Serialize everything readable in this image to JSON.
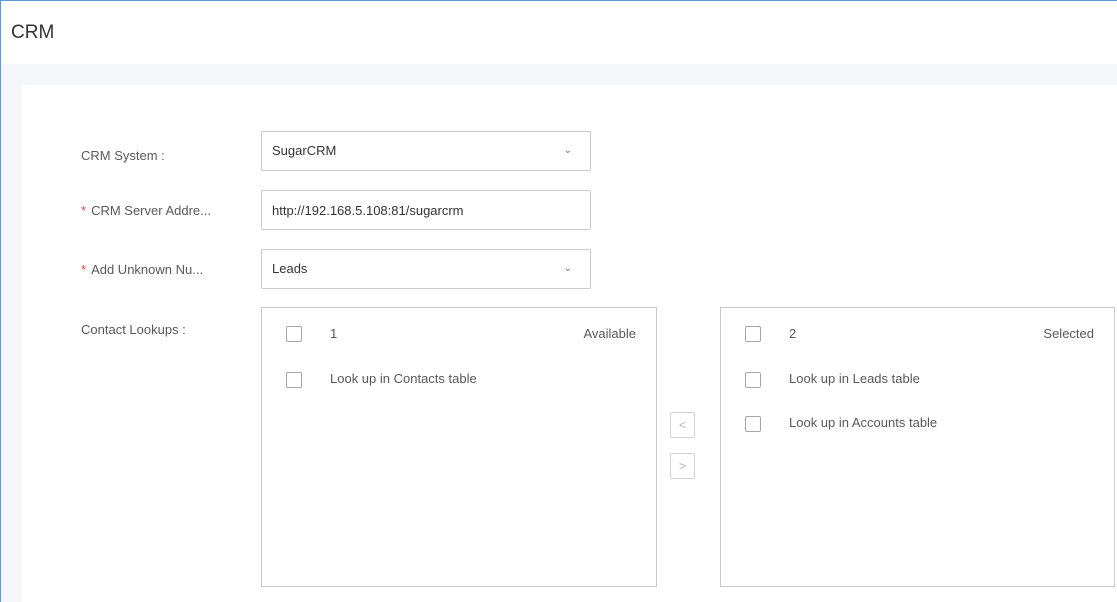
{
  "page": {
    "title": "CRM"
  },
  "form": {
    "crm_system": {
      "label": "CRM System :",
      "value": "SugarCRM"
    },
    "server_address": {
      "label": "CRM Server Addre...",
      "value": "http://192.168.5.108:81/sugarcrm",
      "required_mark": "*"
    },
    "add_unknown": {
      "label": "Add Unknown Nu...",
      "value": "Leads",
      "required_mark": "*"
    },
    "contact_lookups": {
      "label": "Contact Lookups :"
    }
  },
  "available": {
    "count": "1",
    "title": "Available",
    "items": [
      {
        "label": "Look up in Contacts table"
      }
    ]
  },
  "selected": {
    "count": "2",
    "title": "Selected",
    "items": [
      {
        "label": "Look up in Leads table"
      },
      {
        "label": "Look up in Accounts table"
      }
    ]
  },
  "transfer": {
    "left": "<",
    "right": ">"
  },
  "icons": {
    "dropdown": "chevron-down-icon"
  }
}
